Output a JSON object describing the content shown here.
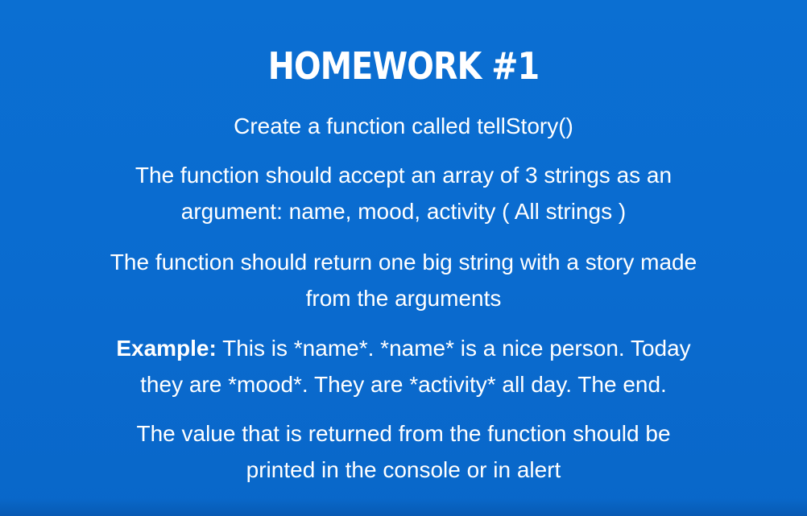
{
  "slide": {
    "title": "HOMEWORK #1",
    "paragraphs": {
      "p1": "Create a function called tellStory()",
      "p2_line1": "The function should accept an array of 3 strings as an",
      "p2_line2": "argument: name, mood, activity ( All strings )",
      "p3_line1": "The function should return one big string with a story made",
      "p3_line2": "from the arguments",
      "p4_label": "Example:",
      "p4_line1": "This is *name*. *name* is a nice person. Today",
      "p4_line2": "they are *mood*. They are *activity* all day. The end.",
      "p5_line1": "The value that is returned from the function should be",
      "p5_line2": "printed in the console or in alert"
    },
    "colors": {
      "background": "#0a6ccf",
      "text": "#ffffff"
    }
  }
}
